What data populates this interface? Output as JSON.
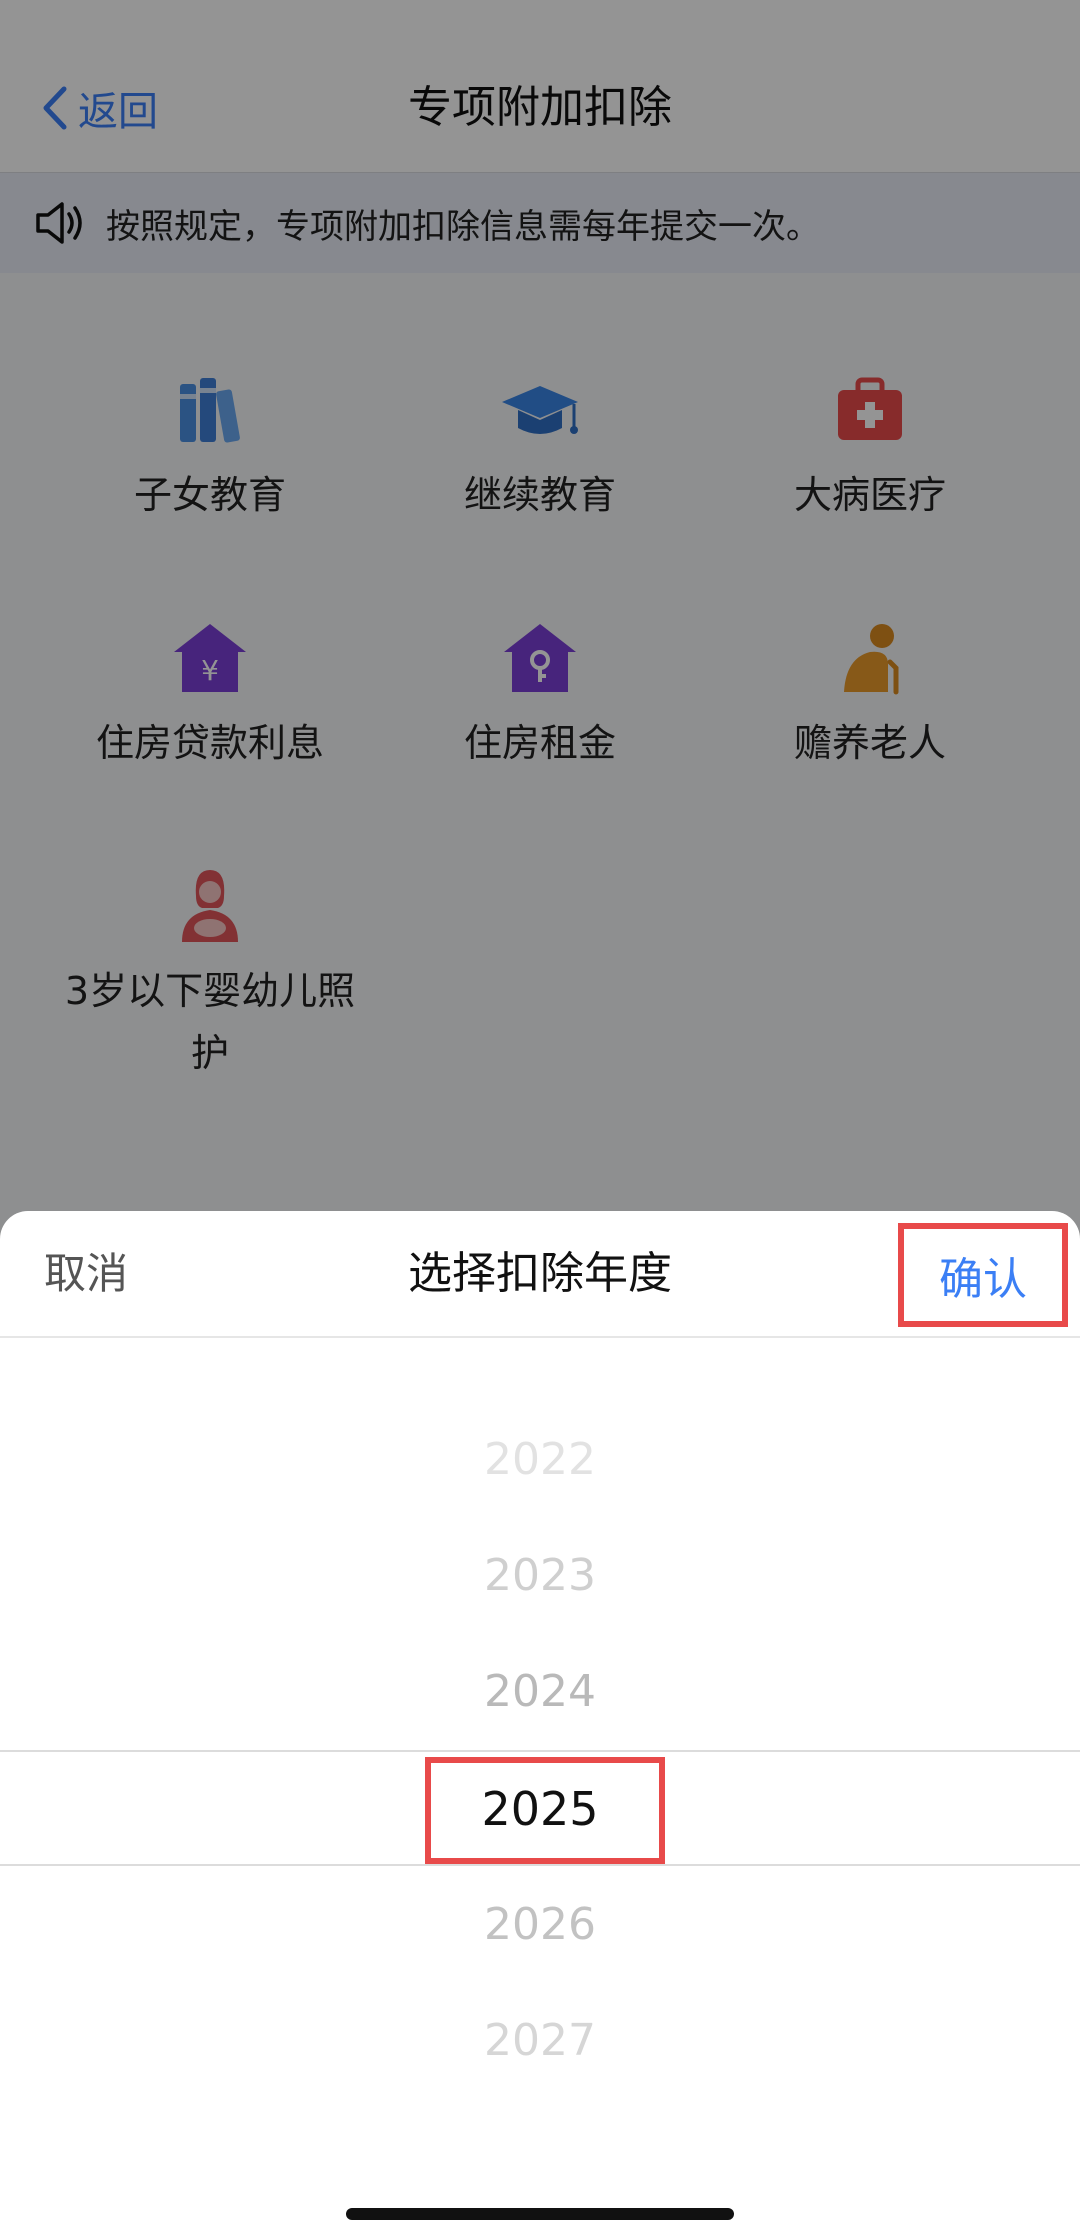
{
  "nav": {
    "back_label": "返回",
    "title": "专项附加扣除"
  },
  "notice": {
    "text": "按照规定，专项附加扣除信息需每年提交一次。"
  },
  "categories": [
    {
      "label": "子女教育",
      "icon": "books-icon"
    },
    {
      "label": "继续教育",
      "icon": "graduation-cap-icon"
    },
    {
      "label": "大病医疗",
      "icon": "medical-kit-icon"
    },
    {
      "label": "住房贷款利息",
      "icon": "house-yuan-icon"
    },
    {
      "label": "住房租金",
      "icon": "house-key-icon"
    },
    {
      "label": "赡养老人",
      "icon": "elderly-person-icon"
    },
    {
      "label": "3岁以下婴幼儿照护",
      "icon": "mother-baby-icon"
    }
  ],
  "sheet": {
    "cancel_label": "取消",
    "title": "选择扣除年度",
    "confirm_label": "确认",
    "years": [
      "2022",
      "2023",
      "2024",
      "2025",
      "2026",
      "2027"
    ],
    "selected_year": "2025"
  },
  "colors": {
    "accent": "#3b7ff5",
    "highlight": "#e84a4a"
  }
}
